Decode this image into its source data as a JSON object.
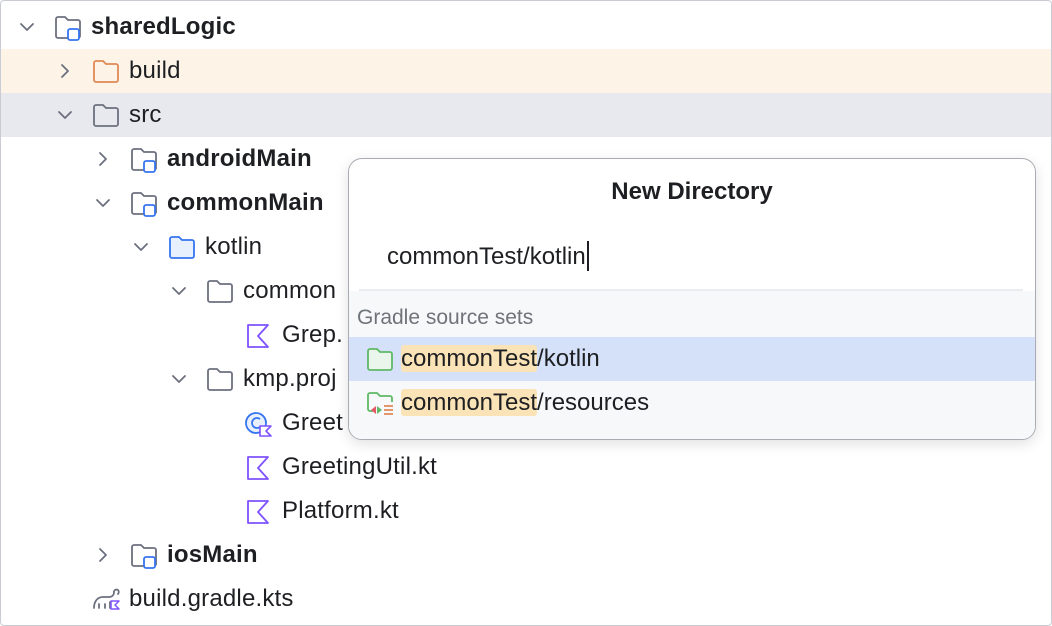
{
  "tree": {
    "root_label": "sharedLogic",
    "build_label": "build",
    "src_label": "src",
    "android_main_label": "androidMain",
    "common_main_label": "commonMain",
    "kotlin_label": "kotlin",
    "common_pkg_label": "common",
    "grep_file_label": "Grep.",
    "kmp_pkg_label": "kmp.proj",
    "greeting_file_label": "Greet",
    "greeting_util_label": "GreetingUtil.kt",
    "platform_label": "Platform.kt",
    "ios_main_label": "iosMain",
    "gradle_file_label": "build.gradle.kts"
  },
  "popup": {
    "title": "New Directory",
    "input_value": "commonTest/kotlin",
    "section_label": "Gradle source sets",
    "suggestions": [
      {
        "match": "commonTest",
        "rest": "/kotlin",
        "icon": "source-folder-icon"
      },
      {
        "match": "commonTest",
        "rest": "/resources",
        "icon": "resources-folder-icon"
      }
    ]
  },
  "colors": {
    "highlight_row": "#fdf4e7",
    "selected_row": "#e7e9ee",
    "active_suggestion": "#d5e1f9",
    "match_highlight": "#fae3b6",
    "module_blue": "#3574f0",
    "kotlin_purple": "#7f52ff",
    "build_orange": "#e08855",
    "source_green": "#5fb865"
  }
}
